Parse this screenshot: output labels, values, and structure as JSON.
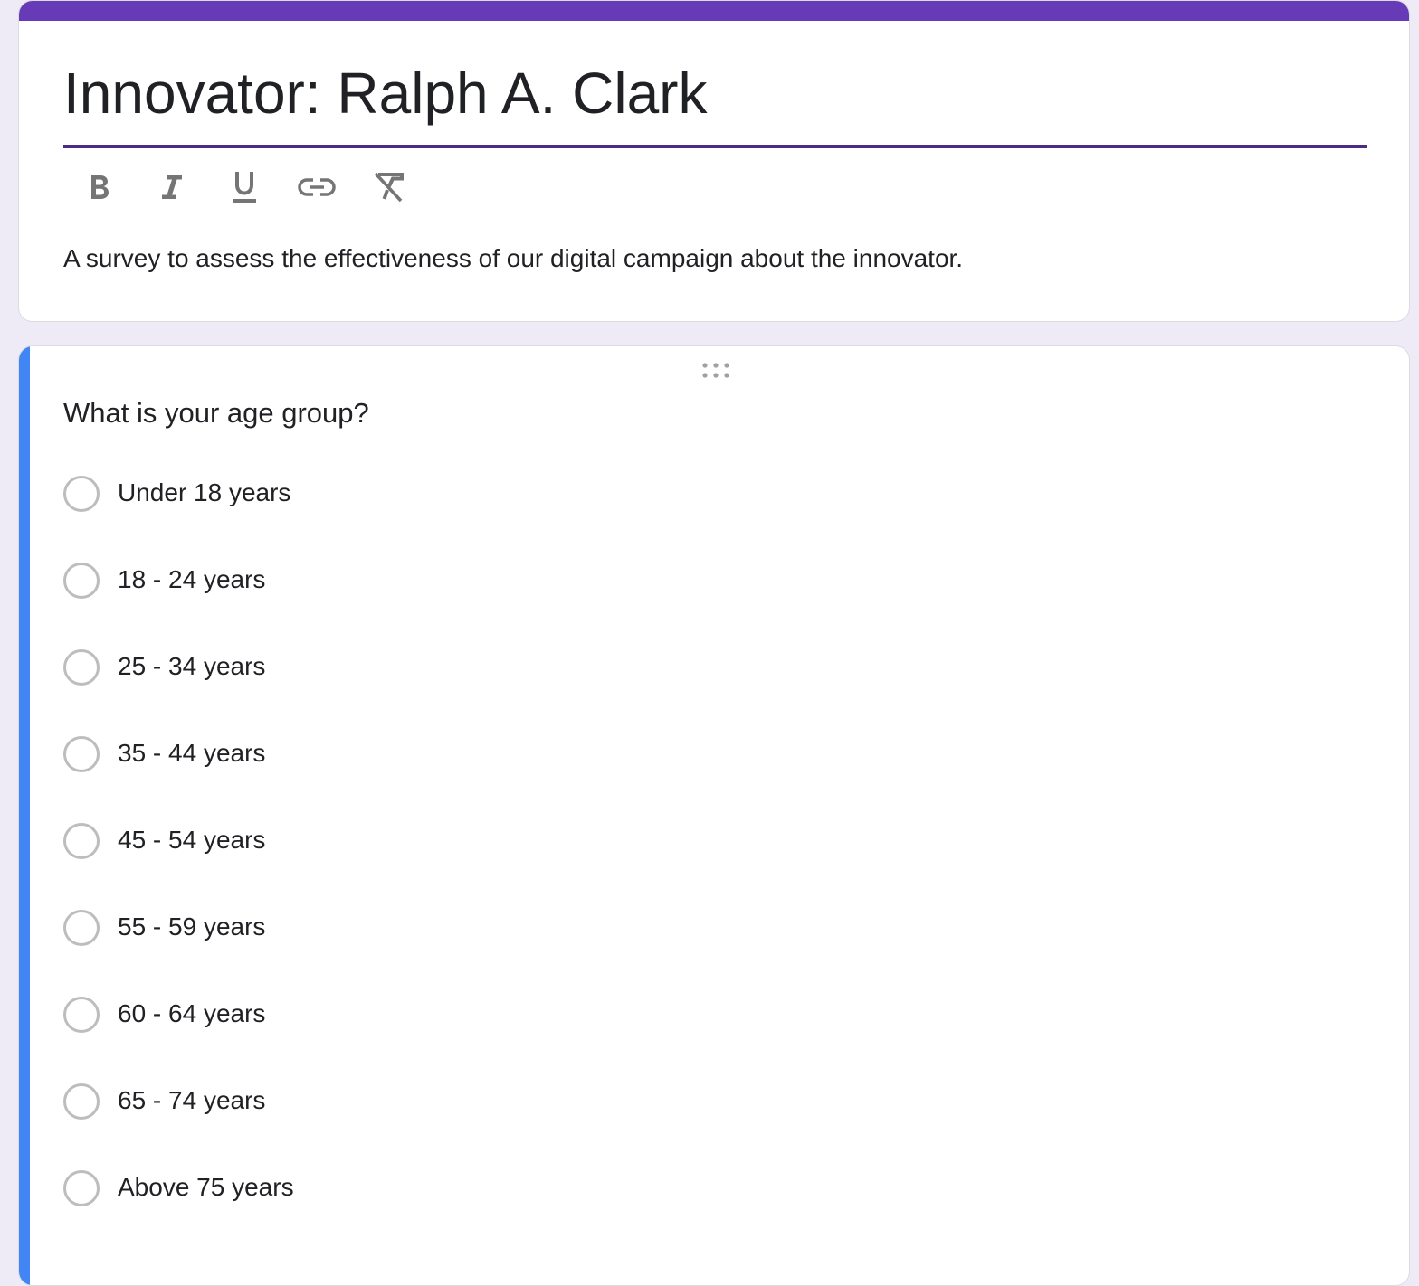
{
  "header": {
    "title": "Innovator: Ralph A. Clark",
    "description": "A survey to assess the effectiveness of our digital campaign about the innovator.",
    "toolbar": [
      {
        "name": "bold-button",
        "icon": "bold-icon"
      },
      {
        "name": "italic-button",
        "icon": "italic-icon"
      },
      {
        "name": "underline-button",
        "icon": "underline-icon"
      },
      {
        "name": "link-button",
        "icon": "link-icon"
      },
      {
        "name": "clear-formatting-button",
        "icon": "clear-formatting-icon"
      }
    ]
  },
  "question": {
    "title": "What is your age group?",
    "drag_handle_icon": "drag-handle-icon",
    "options": [
      "Under 18 years",
      "18 - 24 years",
      "25 - 34 years",
      "35 - 44 years",
      "45 - 54 years",
      "55 - 59 years",
      "60 - 64 years",
      "65 - 74 years",
      "Above 75 years"
    ]
  },
  "colors": {
    "theme_accent": "#673ab7",
    "title_underline": "#4a2c83",
    "active_question_bar": "#4285f4",
    "page_background": "#efebf6",
    "radio_border": "#bdbdbd"
  }
}
